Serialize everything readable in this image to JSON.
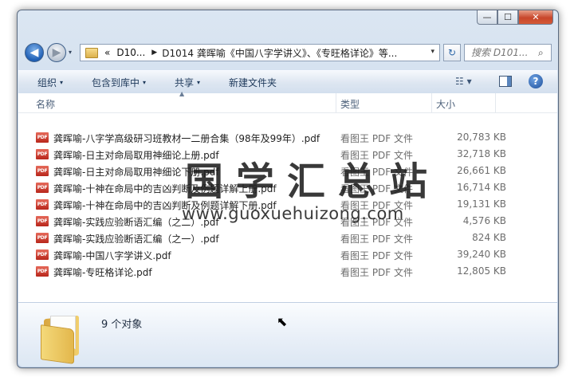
{
  "window": {
    "caption": {
      "minimize": "—",
      "maximize": "☐",
      "close": "✕"
    }
  },
  "navigation": {
    "back_glyph": "◀",
    "forward_glyph": "▶",
    "history_drop": "▾",
    "address": {
      "overflow": "«",
      "segment1": "D10...",
      "arrow": "▶",
      "path": "D1014 龚晖喻《中国八字学讲义》、《专旺格详论》等...",
      "dropdown": "▾"
    },
    "refresh_glyph": "↻",
    "search": {
      "placeholder": "搜索 D101...",
      "icon": "⌕"
    }
  },
  "toolbar": {
    "organize": "组织",
    "include_in_library": "包含到库中",
    "share": "共享",
    "new_folder": "新建文件夹",
    "dropdown": "▾",
    "view_glyph": "☷ ▾",
    "help": "?"
  },
  "columns": {
    "name": "名称",
    "type": "类型",
    "size": "大小",
    "sort": "▲"
  },
  "files": [
    {
      "name": "龚晖喻-八字学高级研习班教材一二册合集（98年及99年）.pdf",
      "type": "看图王 PDF 文件",
      "size": "20,783 KB"
    },
    {
      "name": "龚晖喻-日主对命局取用神细论上册.pdf",
      "type": "看图王 PDF 文件",
      "size": "32,718 KB"
    },
    {
      "name": "龚晖喻-日主对命局取用神细论下册.pdf",
      "type": "看图王 PDF 文件",
      "size": "26,661 KB"
    },
    {
      "name": "龚晖喻-十神在命局中的吉凶判断及例题详解上册.pdf",
      "type": "看图王 PDF 文件",
      "size": "16,714 KB"
    },
    {
      "name": "龚晖喻-十神在命局中的吉凶判断及例题详解下册.pdf",
      "type": "看图王 PDF 文件",
      "size": "19,131 KB"
    },
    {
      "name": "龚晖喻-实践应验断语汇编（之二）.pdf",
      "type": "看图王 PDF 文件",
      "size": "4,576 KB"
    },
    {
      "name": "龚晖喻-实践应验断语汇编（之一）.pdf",
      "type": "看图王 PDF 文件",
      "size": "824 KB"
    },
    {
      "name": "龚晖喻-中国八字学讲义.pdf",
      "type": "看图王 PDF 文件",
      "size": "39,240 KB"
    },
    {
      "name": "龚晖喻-专旺格详论.pdf",
      "type": "看图王 PDF 文件",
      "size": "12,805 KB"
    }
  ],
  "file_icon_text": "PDF",
  "watermark": {
    "title": "国学汇总站",
    "url": "www.guoxuehuizong.com"
  },
  "details": {
    "count": "9 个对象",
    "cursor": "⬉"
  }
}
